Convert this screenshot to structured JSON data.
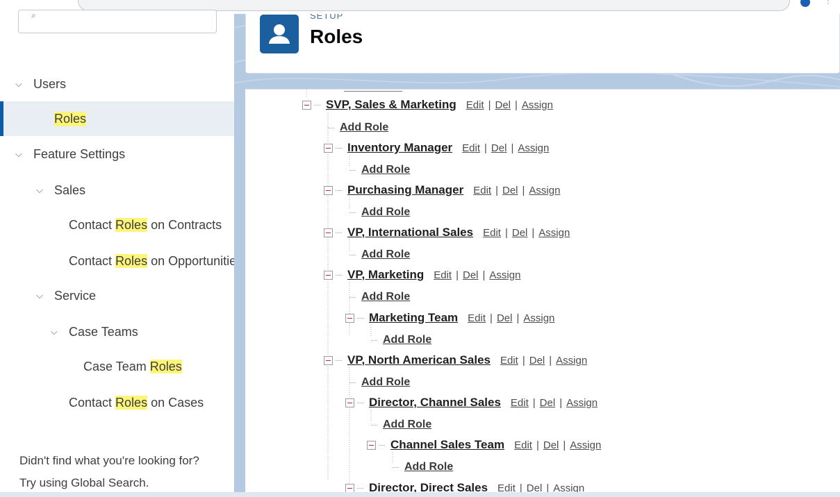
{
  "sidebar": {
    "users": "Users",
    "roles": "Roles",
    "feature_settings": "Feature Settings",
    "sales": "Sales",
    "contact_roles_contracts_prefix": "Contact ",
    "contact_roles_contracts_hl": "Roles",
    "contact_roles_contracts_suffix": " on Contracts",
    "contact_roles_opps_prefix": "Contact ",
    "contact_roles_opps_hl": "Roles",
    "contact_roles_opps_suffix": " on Opportunities",
    "service": "Service",
    "case_teams": "Case Teams",
    "case_team_roles_prefix": "Case Team ",
    "case_team_roles_hl": "Roles",
    "contact_roles_cases_prefix": "Contact ",
    "contact_roles_cases_hl": "Roles",
    "contact_roles_cases_suffix": " on Cases",
    "footer_line1": "Didn't find what you're looking for?",
    "footer_line2": "Try using Global Search."
  },
  "header": {
    "setup_label": "SETUP",
    "title": "Roles"
  },
  "actions": {
    "edit": "Edit",
    "del": "Del",
    "assign": "Assign",
    "add_role": "Add Role",
    "separator": "|"
  },
  "tree": {
    "svp_sales_marketing": "SVP, Sales & Marketing",
    "inventory_manager": "Inventory Manager",
    "purchasing_manager": "Purchasing Manager",
    "vp_international_sales": "VP, International Sales",
    "vp_marketing": "VP, Marketing",
    "marketing_team": "Marketing Team",
    "vp_north_american_sales": "VP, North American Sales",
    "director_channel_sales": "Director, Channel Sales",
    "channel_sales_team": "Channel Sales Team",
    "director_direct_sales": "Director, Direct Sales"
  },
  "colors": {
    "accent": "#0b5cab",
    "highlight": "#fdf57a",
    "toggle_minus": "#c2185b",
    "backdrop": "#b4c9e2"
  }
}
